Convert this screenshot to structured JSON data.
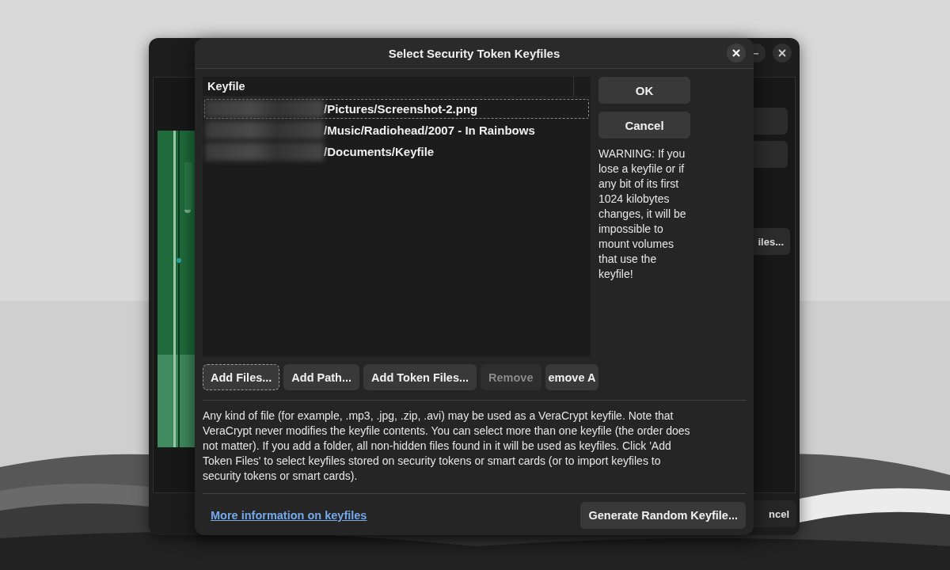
{
  "background_window": {
    "title_controls": [
      {
        "kind": "minimize"
      },
      {
        "kind": "close"
      }
    ],
    "buttons": [
      {
        "kind": "blank"
      },
      {
        "kind": "blank"
      },
      {
        "kind": "text",
        "label": "iles..."
      },
      {
        "kind": "text",
        "label": "ncel"
      }
    ]
  },
  "dialog": {
    "title": "Select Security Token Keyfiles",
    "table": {
      "columns": [
        "Keyfile"
      ],
      "rows": [
        {
          "redacted": true,
          "path": "/Pictures/Screenshot-2.png",
          "focused": true
        },
        {
          "redacted": true,
          "path": "/Music/Radiohead/2007 - In Rainbows",
          "focused": false
        },
        {
          "redacted": true,
          "path": "/Documents/Keyfile",
          "focused": false
        }
      ]
    },
    "side_buttons": [
      "OK",
      "Cancel"
    ],
    "warning": "WARNING: If you lose a keyfile or if any bit of its first 1024 kilobytes changes, it will be impossible to mount volumes that use the keyfile!",
    "buttons": [
      {
        "label": "Add Files...",
        "focused": true,
        "disabled": false
      },
      {
        "label": "Add Path...",
        "focused": false,
        "disabled": false
      },
      {
        "label": "Add Token Files...",
        "focused": false,
        "disabled": false
      },
      {
        "label": "Remove",
        "focused": false,
        "disabled": true
      },
      {
        "label": "emove A",
        "focused": false,
        "disabled": false
      }
    ],
    "description": "Any kind of file (for example, .mp3, .jpg, .zip, .avi) may be used as a VeraCrypt keyfile. Note that VeraCrypt never modifies the keyfile contents. You can select more than one keyfile (the order does not matter). If you add a folder, all non-hidden files found in it will be used as keyfiles. Click 'Add Token Files' to select keyfiles stored on security tokens or smart cards (or to import keyfiles to security tokens or smart cards).",
    "link": "More information on keyfiles",
    "generate_button": "Generate Random Keyfile..."
  }
}
